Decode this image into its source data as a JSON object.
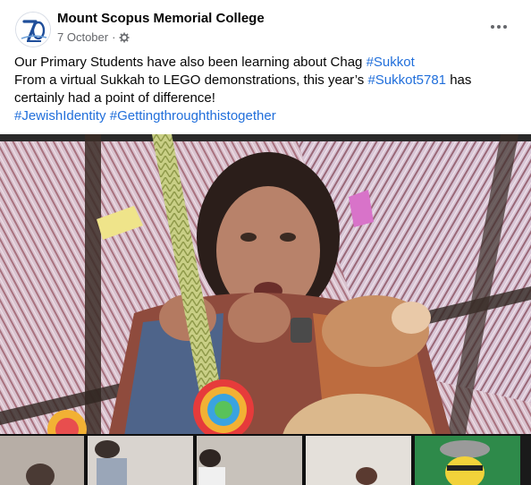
{
  "post": {
    "page_name": "Mount Scopus Memorial College",
    "date": "7 October",
    "separator": "·",
    "privacy_icon": "gear-icon",
    "more_icon": "more-options-icon",
    "logo_text": "70",
    "text": {
      "line1_prefix": "Our Primary Students have also been learning about Chag ",
      "line1_tag": "#Sukkot",
      "line2_prefix": "From a virtual Sukkah to LEGO demonstrations, this year’s ",
      "line2_tag": "#Sukkot5781",
      "line2_suffix": " has",
      "line3": "certainly had a point of difference!",
      "line4_tag1": "#JewishIdentity",
      "line4_tag2": "#Gettingthroughthistogether"
    },
    "media": {
      "type": "video-call-screenshot",
      "tile_count": 5
    },
    "colors": {
      "link": "#216fdb",
      "secondary_text": "#65676b",
      "logo_blue": "#1f4e9a"
    }
  }
}
